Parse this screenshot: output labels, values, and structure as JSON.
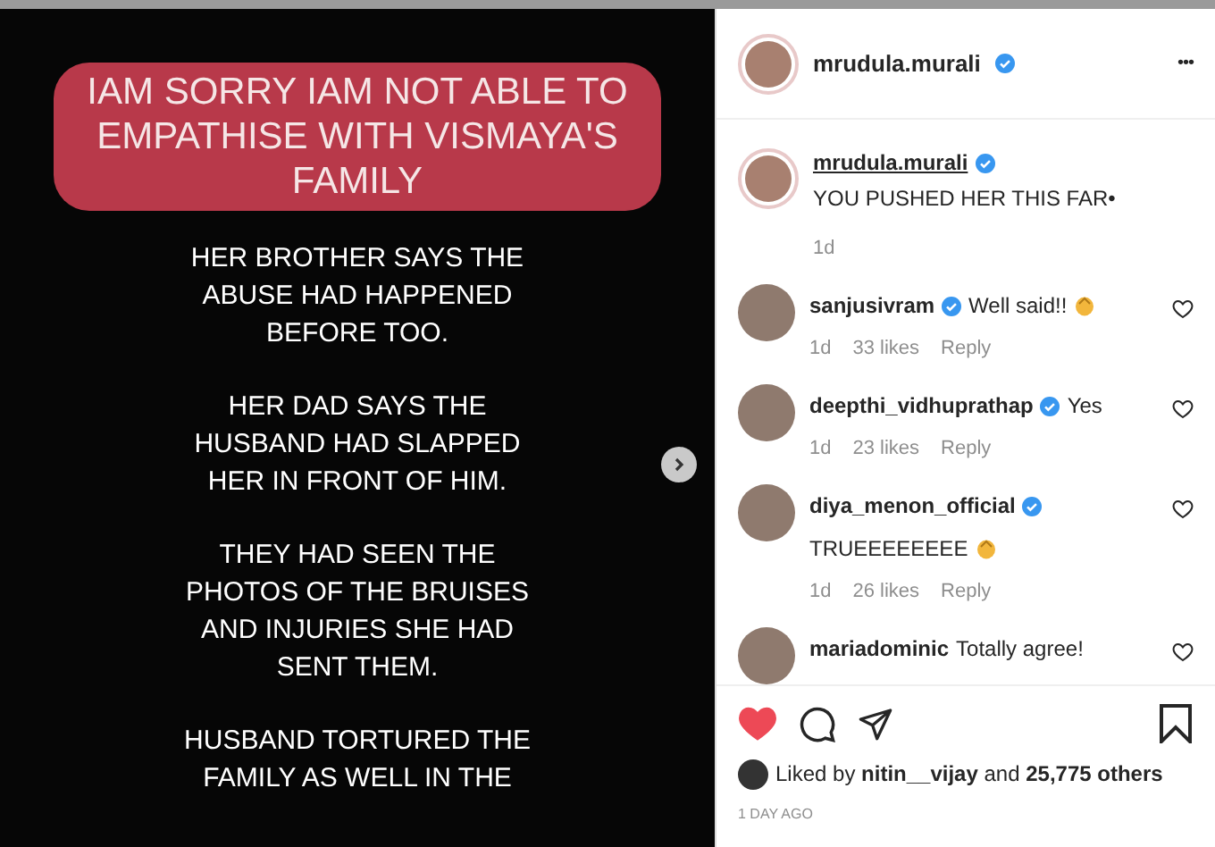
{
  "post": {
    "headline": "IAM SORRY IAM NOT ABLE TO EMPATHISE WITH VISMAYA'S FAMILY",
    "paragraphs": [
      "HER BROTHER SAYS THE ABUSE HAD HAPPENED BEFORE TOO.",
      "HER DAD SAYS THE HUSBAND HAD SLAPPED HER IN FRONT OF HIM.",
      "THEY HAD SEEN THE PHOTOS OF THE BRUISES AND INJURIES SHE HAD SENT THEM.",
      "HUSBAND TORTURED THE FAMILY AS WELL IN THE"
    ]
  },
  "header": {
    "username": "mrudula.murali",
    "verified": true,
    "more": "•••"
  },
  "caption": {
    "username": "mrudula.murali",
    "verified": true,
    "text": "YOU PUSHED HER THIS FAR•",
    "time": "1d"
  },
  "comments": [
    {
      "username": "sanjusivram",
      "verified": true,
      "text": "Well said!!",
      "clap": true,
      "inline": true,
      "time": "1d",
      "likes": "33 likes",
      "reply": "Reply"
    },
    {
      "username": "deepthi_vidhuprathap",
      "verified": true,
      "text": "Yes",
      "clap": false,
      "inline": true,
      "time": "1d",
      "likes": "23 likes",
      "reply": "Reply"
    },
    {
      "username": "diya_menon_official",
      "verified": true,
      "text": "TRUEEEEEEEE",
      "clap": true,
      "inline": false,
      "time": "1d",
      "likes": "26 likes",
      "reply": "Reply"
    },
    {
      "username": "mariadominic",
      "verified": false,
      "text": "Totally agree!",
      "clap": false,
      "inline": true
    }
  ],
  "actions": {
    "liked": true
  },
  "likes": "Liked by **nitin__vijay** and **25,775 others**",
  "posted": "1 DAY AGO"
}
